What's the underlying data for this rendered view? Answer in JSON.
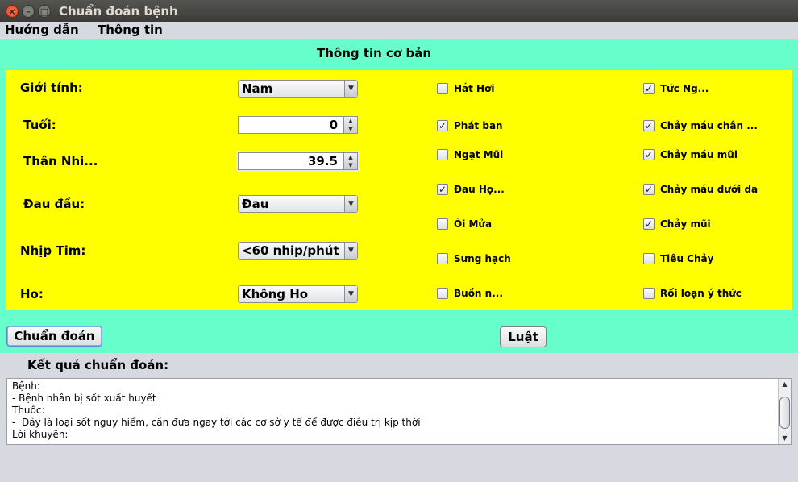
{
  "window": {
    "title": "Chuẩn đoán bệnh",
    "close_glyph": "×",
    "min_glyph": "–",
    "max_glyph": "□"
  },
  "menubar": {
    "items": [
      "Hướng dẫn",
      "Thông tin"
    ]
  },
  "form": {
    "section_title": "Thông tin cơ bản",
    "gender": {
      "label": "Giới tính:",
      "value": "Nam"
    },
    "age": {
      "label": "Tuổi:",
      "value": "0"
    },
    "temperature": {
      "label": "Thân Nhi...",
      "value": "39.5"
    },
    "headache": {
      "label": "Đau đầu:",
      "value": "Đau"
    },
    "heart_rate": {
      "label": "Nhịp Tim:",
      "value": "<60 nhip/phút"
    },
    "cough": {
      "label": "Ho:",
      "value": "Không Ho"
    }
  },
  "symptoms_left": [
    {
      "label": "Hắt Hơi",
      "checked": false
    },
    {
      "label": "Phát ban",
      "checked": true
    },
    {
      "label": "Ngạt Mũi",
      "checked": false
    },
    {
      "label": "Đau Họ...",
      "checked": true
    },
    {
      "label": "Ói Mửa",
      "checked": false
    },
    {
      "label": "Sưng hạch",
      "checked": false
    },
    {
      "label": "Buồn n...",
      "checked": false
    }
  ],
  "symptoms_right": [
    {
      "label": "Tức Ng...",
      "checked": true
    },
    {
      "label": "Chảy máu chân ...",
      "checked": true
    },
    {
      "label": "Chảy máu mũi",
      "checked": true
    },
    {
      "label": "Chảy máu dưới da",
      "checked": true
    },
    {
      "label": "Chảy mũi",
      "checked": true
    },
    {
      "label": "Tiêu Chảy",
      "checked": false
    },
    {
      "label": "Rối loạn ý thức",
      "checked": false
    }
  ],
  "buttons": {
    "diagnose": "Chuẩn đoán",
    "rules": "Luật"
  },
  "result": {
    "label": "Kết quả chuẩn đoán:",
    "lines": [
      "Bệnh:",
      "- Bệnh nhân bị sốt xuất huyết",
      "Thuốc:",
      "-  Đây là loại sốt nguy hiểm, cần đưa ngay tới các cơ sở y tế để được điều trị kịp thời",
      "Lời khuyên:"
    ]
  },
  "glyphs": {
    "check": "✓",
    "dropdown": "▼",
    "spin_up": "▲",
    "spin_down": "▼"
  },
  "colors": {
    "panel_bg": "#66ffcc",
    "form_bg": "#ffff00",
    "window_bg": "#d6d9df"
  }
}
